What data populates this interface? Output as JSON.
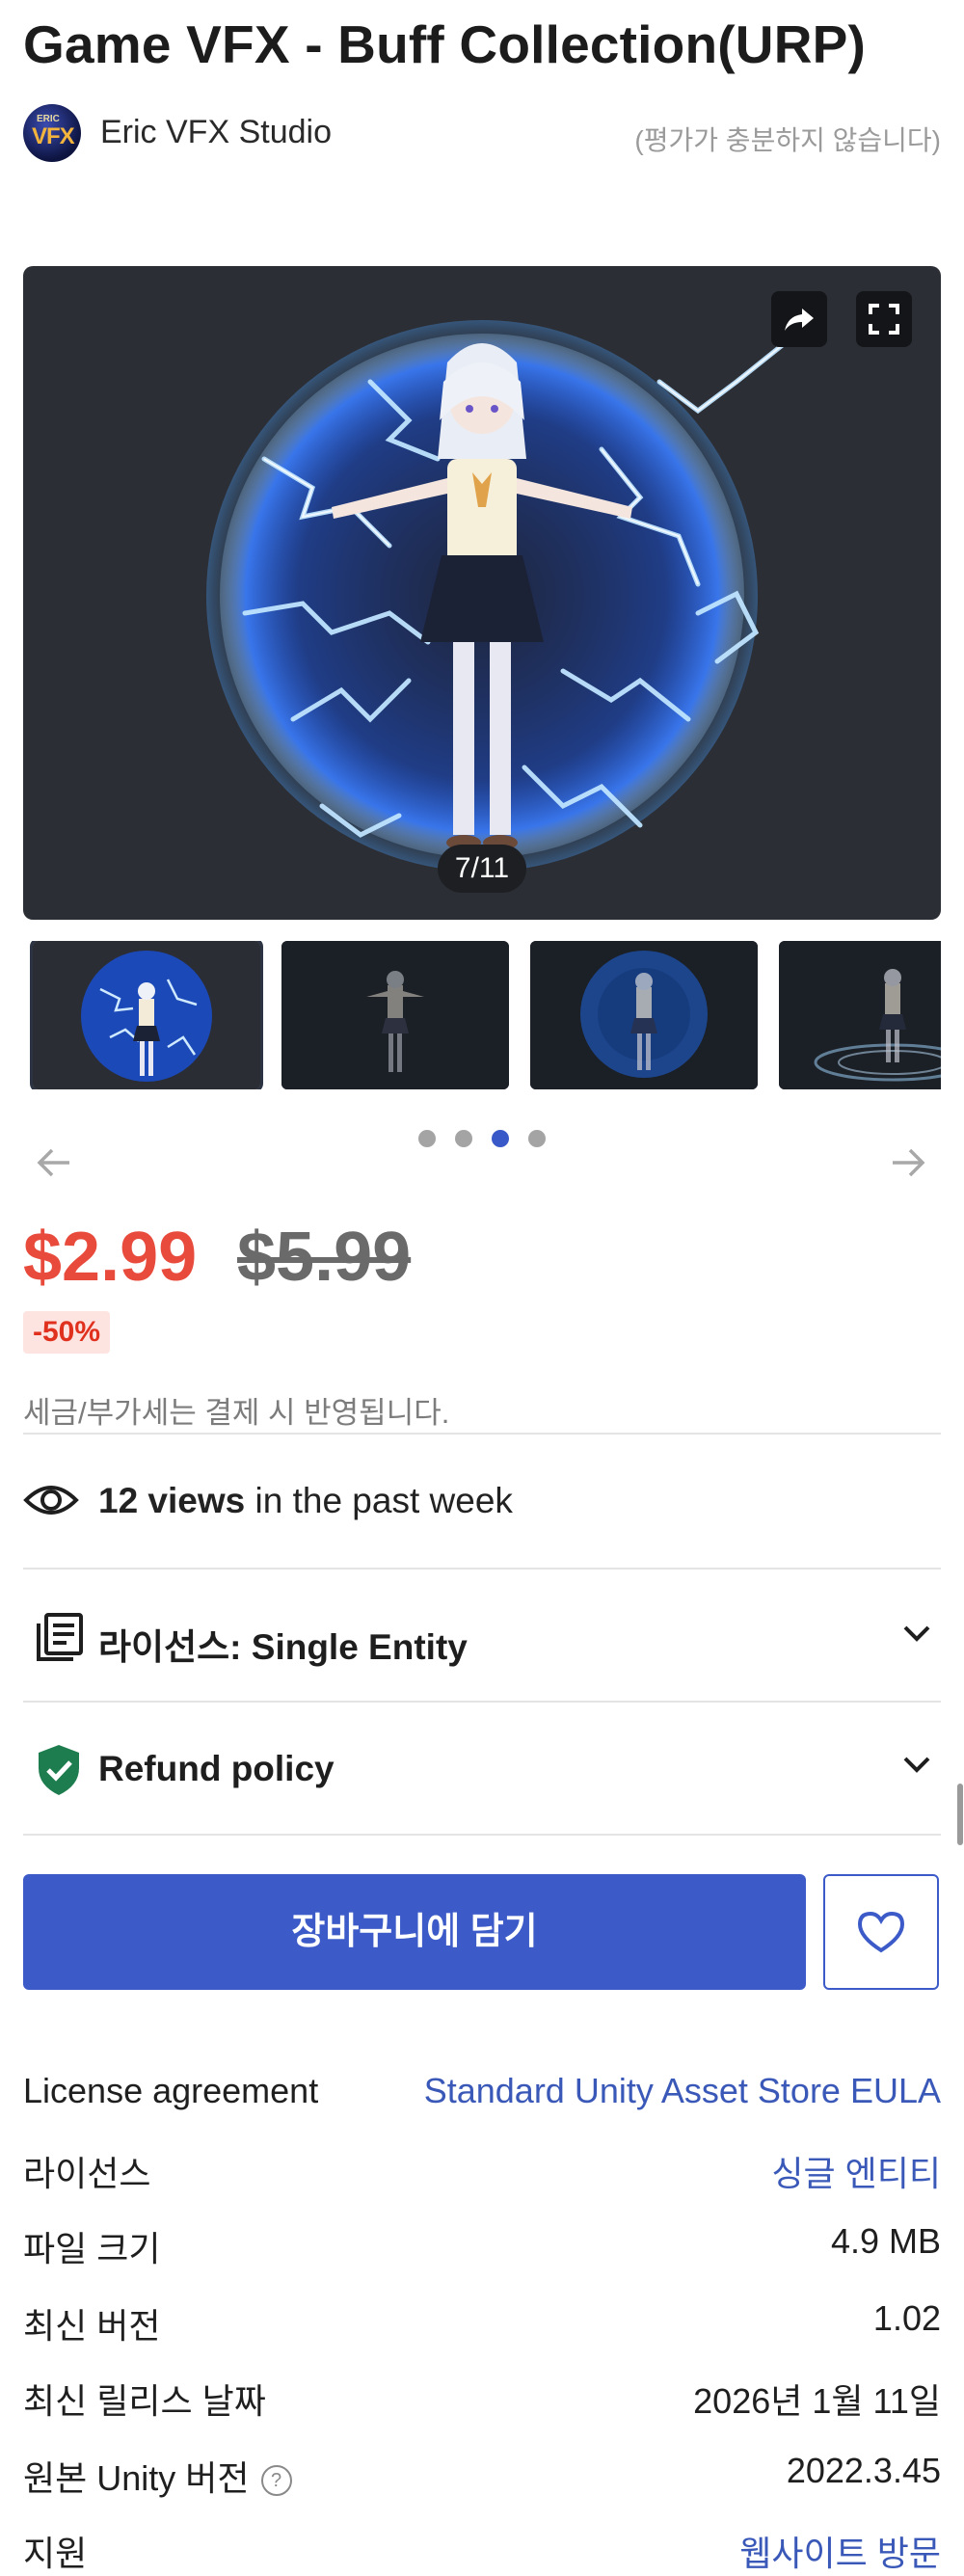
{
  "product": {
    "title": "Game VFX - Buff Collection(URP)",
    "publisher": "Eric VFX Studio",
    "publisher_avatar_text_small": "ERIC",
    "publisher_avatar_text_big": "VFX",
    "rating_note": "(평가가 충분하지 않습니다)"
  },
  "gallery": {
    "counter": "7/11",
    "share_icon": "share-arrow",
    "fullscreen_icon": "fullscreen-corners",
    "thumbnail_count": 4,
    "dots_total": 4,
    "active_dot": 3
  },
  "price": {
    "current": "$2.99",
    "original": "$5.99",
    "discount": "-50%",
    "tax_note": "세금/부가세는 결제 시 반영됩니다.",
    "accent_color": "#e84a3b"
  },
  "views": {
    "count": "12 views",
    "suffix": " in the past week"
  },
  "accordions": [
    {
      "label": "라이선스: Single Entity",
      "icon": "document-list"
    },
    {
      "label": "Refund policy",
      "icon": "shield-check"
    }
  ],
  "actions": {
    "add_to_cart": "장바구니에 담기",
    "wishlist_icon": "heart-outline",
    "primary_color": "#3c5bc8"
  },
  "details": [
    {
      "key": "License agreement",
      "value": "Standard Unity Asset Store EULA",
      "link": true
    },
    {
      "key": "라이선스",
      "value": "싱글 엔티티",
      "link": true
    },
    {
      "key": "파일 크기",
      "value": "4.9 MB",
      "link": false
    },
    {
      "key": "최신 버전",
      "value": "1.02",
      "link": false
    },
    {
      "key": "최신 릴리스 날짜",
      "value": "2026년 1월 11일",
      "link": false
    },
    {
      "key": "원본 Unity 버전",
      "value": "2022.3.45",
      "link": false,
      "help": "?"
    },
    {
      "key": "지원",
      "value": "웹사이트 방문",
      "link": true
    }
  ]
}
